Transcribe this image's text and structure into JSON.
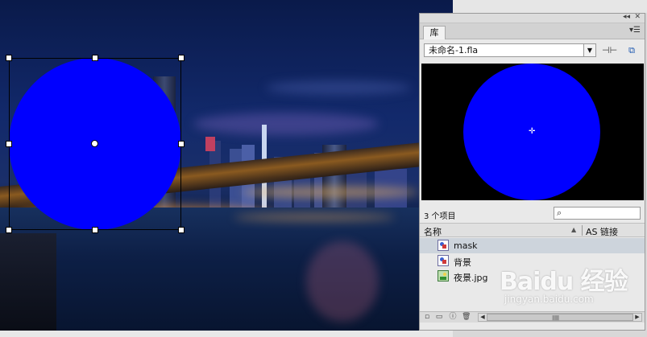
{
  "library_panel": {
    "tab_label": "库",
    "menu_icon": "panel-menu-icon",
    "document_name": "未命名-1.fla",
    "item_count": "3 个项目",
    "search_placeholder": "",
    "columns": {
      "name": "名称",
      "linkage": "AS 链接"
    },
    "items": [
      {
        "label": "mask",
        "type": "graphic-symbol",
        "selected": true
      },
      {
        "label": "背景",
        "type": "graphic-symbol",
        "selected": false
      },
      {
        "label": "夜景.jpg",
        "type": "bitmap",
        "selected": false
      }
    ],
    "bottom_icons": [
      "new-symbol-icon",
      "new-folder-icon",
      "properties-icon",
      "delete-icon"
    ]
  },
  "stage": {
    "circle_color": "#0000ff",
    "background": "night city skyline with bridge"
  },
  "watermark": {
    "logo": "Baidu 经验",
    "url": "jingyan.baidu.com"
  },
  "colors": {
    "shape_fill": "#0000ff",
    "preview_bg": "#000000",
    "selected_row": "#cdd4dc"
  }
}
